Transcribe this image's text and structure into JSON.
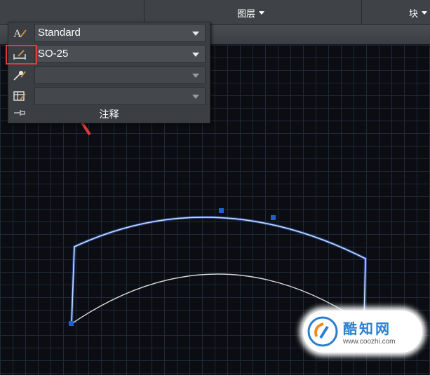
{
  "ribbon": {
    "layers_label": "图层",
    "block_label": "块"
  },
  "annotation_panel": {
    "title": "注释",
    "text_style": {
      "value": "Standard",
      "icon": "text-style-icon"
    },
    "dimension_style": {
      "value": "SO-25",
      "icon": "dimension-style-icon"
    },
    "multileader_style": {
      "value": "",
      "icon": "multileader-style-icon"
    },
    "table_style": {
      "value": "",
      "icon": "table-style-icon"
    },
    "pin_icon": "pin-icon"
  },
  "watermark": {
    "name": "酷知网",
    "url": "www.coozhi.com"
  },
  "colors": {
    "highlight": "#e03a3a",
    "selected_curve": "#7fa8ff",
    "grip": "#1f5fd6",
    "curve": "#d8d8d8",
    "brand": "#2b7fd0"
  }
}
